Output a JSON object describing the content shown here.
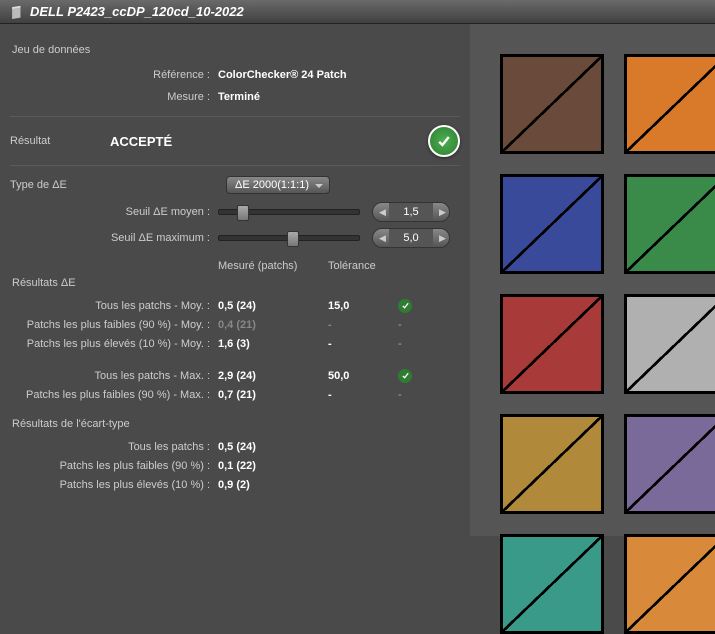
{
  "title": "DELL P2423_ccDP_120cd_10-2022",
  "dataset": {
    "heading": "Jeu de données",
    "ref_lbl": "Référence :",
    "ref_val": "ColorChecker® 24 Patch",
    "meas_lbl": "Mesure :",
    "meas_val": "Terminé"
  },
  "result": {
    "lbl": "Résultat",
    "val": "ACCEPTÉ"
  },
  "deType": {
    "lbl": "Type de ΔE",
    "val": "ΔE 2000(1:1:1)"
  },
  "thresholds": {
    "avg_lbl": "Seuil ΔE moyen :",
    "avg_val": "1,5",
    "max_lbl": "Seuil ΔE maximum :",
    "max_val": "5,0"
  },
  "cols": {
    "measured": "Mesuré (patchs)",
    "tol": "Tolérance"
  },
  "deResults": {
    "heading": "Résultats ΔE",
    "rows": [
      {
        "lbl": "Tous les patchs - Moy. :",
        "val": "0,5  (24)",
        "tol": "15,0",
        "ok": true
      },
      {
        "lbl": "Patchs les plus faibles (90 %) - Moy. :",
        "val": "0,4  (21)",
        "tol": "-",
        "ok": false,
        "muted": true
      },
      {
        "lbl": "Patchs les plus élevés (10 %) - Moy. :",
        "val": "1,6  (3)",
        "tol": "-",
        "ok": false
      },
      {
        "lbl": "Tous les patchs - Max. :",
        "val": "2,9  (24)",
        "tol": "50,0",
        "ok": true,
        "gap": true
      },
      {
        "lbl": "Patchs les plus faibles (90 %) - Max. :",
        "val": "0,7  (21)",
        "tol": "-",
        "ok": false
      }
    ]
  },
  "stdResults": {
    "heading": "Résultats de l'écart-type",
    "rows": [
      {
        "lbl": "Tous les patchs :",
        "val": "0,5  (24)"
      },
      {
        "lbl": "Patchs les plus faibles (90 %) :",
        "val": "0,1  (22)"
      },
      {
        "lbl": "Patchs les plus élevés (10 %) :",
        "val": "0,9  (2)"
      }
    ]
  },
  "swatches": [
    "#6a4a3a",
    "#d87a2a",
    "#3a4a9a",
    "#3a8a4a",
    "#a83a3a",
    "#b0b0b0",
    "#b08a3a",
    "#7a6a9a",
    "#3a9a8a",
    "#d88a3a"
  ]
}
